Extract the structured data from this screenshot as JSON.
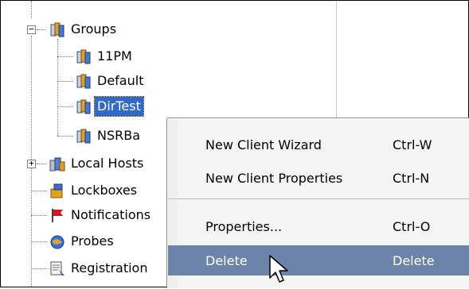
{
  "tree": {
    "groups": {
      "label": "Groups",
      "children": [
        "11PM",
        "Default",
        "DirTest",
        "NSRBa"
      ]
    },
    "nodes": [
      "Local Hosts",
      "Lockboxes",
      "Notifications",
      "Probes",
      "Registration"
    ],
    "selected": "DirTest"
  },
  "context_menu": {
    "items": [
      {
        "label": "New Client Wizard",
        "shortcut": "Ctrl-W"
      },
      {
        "label": "New Client Properties",
        "shortcut": "Ctrl-N"
      },
      {
        "label": "Properties...",
        "shortcut": "Ctrl-O"
      },
      {
        "label": "Delete",
        "shortcut": "Delete"
      }
    ],
    "highlighted": "Delete"
  },
  "colors": {
    "selection": "#316ac5",
    "menu_highlight": "#6b84a8",
    "menu_background": "#f5f5f5"
  },
  "icons": {
    "group": "server-group-icon",
    "local_hosts": "local-hosts-icon",
    "lockboxes": "lockbox-icon",
    "notifications": "flag-icon",
    "probes": "globe-icon",
    "registration": "registration-icon",
    "cursor": "mouse-pointer-icon"
  }
}
